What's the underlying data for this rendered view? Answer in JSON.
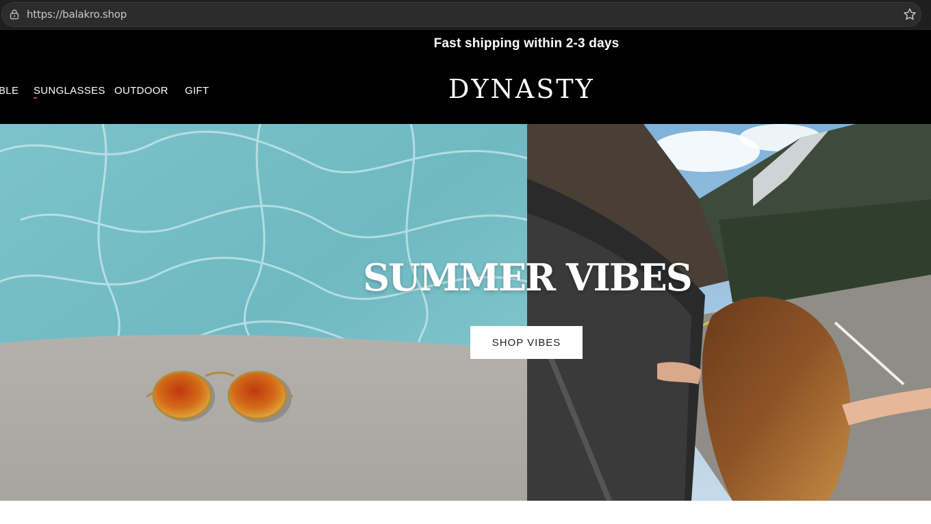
{
  "browser": {
    "url": "https://balakro.shop",
    "icons": {
      "lock": "lock-icon",
      "bookmark": "star-icon"
    }
  },
  "announcement": {
    "text": "Fast shipping within 2-3 days"
  },
  "header": {
    "logo": "DYNASTY",
    "nav": [
      {
        "label": "BLE"
      },
      {
        "label": "SUNGLASSES",
        "active": true
      },
      {
        "label": "OUTDOOR"
      },
      {
        "label": "GIFT"
      }
    ]
  },
  "hero": {
    "title": "SUMMER VIBES",
    "button_label": "SHOP VIBES",
    "images": {
      "left": "aviator sunglasses on pool edge",
      "right": "woman leaning out of car window on mountain road"
    }
  },
  "colors": {
    "header_bg": "#000000",
    "browser_bg": "#1f1f1f",
    "text_light": "#ffffff",
    "accent": "#dd3333"
  }
}
